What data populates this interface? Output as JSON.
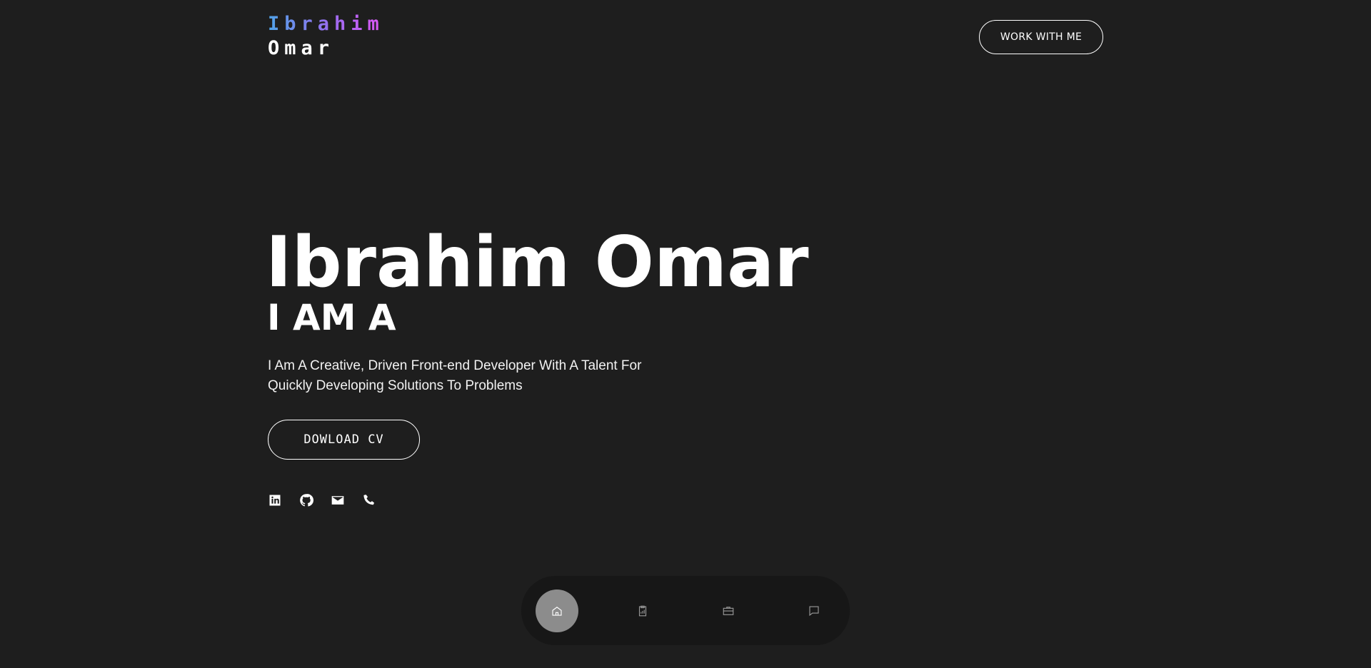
{
  "logo": {
    "first": "Ibrahim",
    "last": "Omar"
  },
  "header": {
    "cta_label": "WORK WITH ME"
  },
  "hero": {
    "name": "Ibrahim Omar",
    "role": "I AM A",
    "description": "I Am A Creative, Driven Front-end Developer With A Talent For Quickly Developing Solutions To Problems",
    "cv_label": "DOWLOAD CV"
  },
  "socials": [
    "linkedin-icon",
    "github-icon",
    "mail-icon",
    "phone-icon"
  ],
  "nav": {
    "items": [
      "home-icon",
      "resume-icon",
      "briefcase-icon",
      "chat-icon"
    ],
    "active": "home-icon"
  },
  "colors": {
    "background": "#1e1e1e",
    "nav_background": "#171717",
    "nav_active": "#8c8c8c",
    "logo_gradient": [
      "#4fa3e8",
      "#9b6cf0",
      "#e056f5"
    ]
  }
}
